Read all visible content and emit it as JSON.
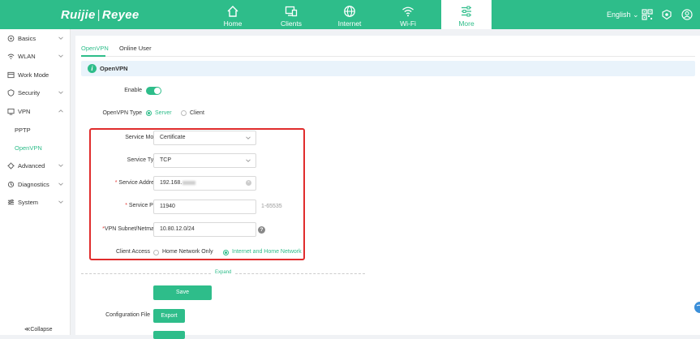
{
  "brand": {
    "logo_left": "Ruijie",
    "logo_sep": "|",
    "logo_right": "Reyee"
  },
  "topnav": [
    {
      "label": "Home",
      "icon": "home-icon"
    },
    {
      "label": "Clients",
      "icon": "clients-icon"
    },
    {
      "label": "Internet",
      "icon": "globe-icon"
    },
    {
      "label": "Wi-Fi",
      "icon": "wifi-icon"
    },
    {
      "label": "More",
      "icon": "more-icon",
      "active": true
    }
  ],
  "header": {
    "language": "English ⌄"
  },
  "sidebar": {
    "items": [
      {
        "label": "Basics",
        "icon": "basics-icon"
      },
      {
        "label": "WLAN",
        "icon": "wlan-icon"
      },
      {
        "label": "Work Mode",
        "icon": "workmode-icon"
      },
      {
        "label": "Security",
        "icon": "security-icon"
      },
      {
        "label": "VPN",
        "icon": "vpn-icon"
      },
      {
        "label": "Advanced",
        "icon": "advanced-icon"
      },
      {
        "label": "Diagnostics",
        "icon": "diagnostics-icon"
      },
      {
        "label": "System",
        "icon": "system-icon"
      }
    ],
    "vpn_sub": [
      "PPTP",
      "OpenVPN"
    ],
    "collapse": "≪Collapse"
  },
  "tabs": [
    "OpenVPN",
    "Online User"
  ],
  "banner": {
    "title": "OpenVPN",
    "icon": "info-icon"
  },
  "form": {
    "enable_label": "Enable",
    "enable_on": true,
    "type_label": "OpenVPN Type",
    "type_options": [
      "Server",
      "Client"
    ],
    "type_selected": "Server",
    "service_mode_label": "Service Mode",
    "service_mode_value": "Certificate",
    "service_type_label": "Service Type",
    "service_type_value": "TCP",
    "service_address_label": "Service Address",
    "service_address_value": "192.168.",
    "service_port_label": "Service Port",
    "service_port_value": "11940",
    "service_port_hint": "1-65535",
    "subnet_label": "VPN Subnet/Netmask",
    "subnet_value": "10.80.12.0/24",
    "client_access_label": "Client Access",
    "client_access_options": [
      "Home Network Only",
      "Internet and Home Network"
    ],
    "client_access_selected": "Internet and Home Network",
    "required_mark": "*",
    "help_mark": "?",
    "expand": "Expand",
    "save": "Save",
    "config_file_label": "Configuration File",
    "export": "Export"
  },
  "colors": {
    "accent": "#2ebd8a",
    "highlight": "#e02c2c",
    "banner_bg": "#e9f3fb"
  }
}
